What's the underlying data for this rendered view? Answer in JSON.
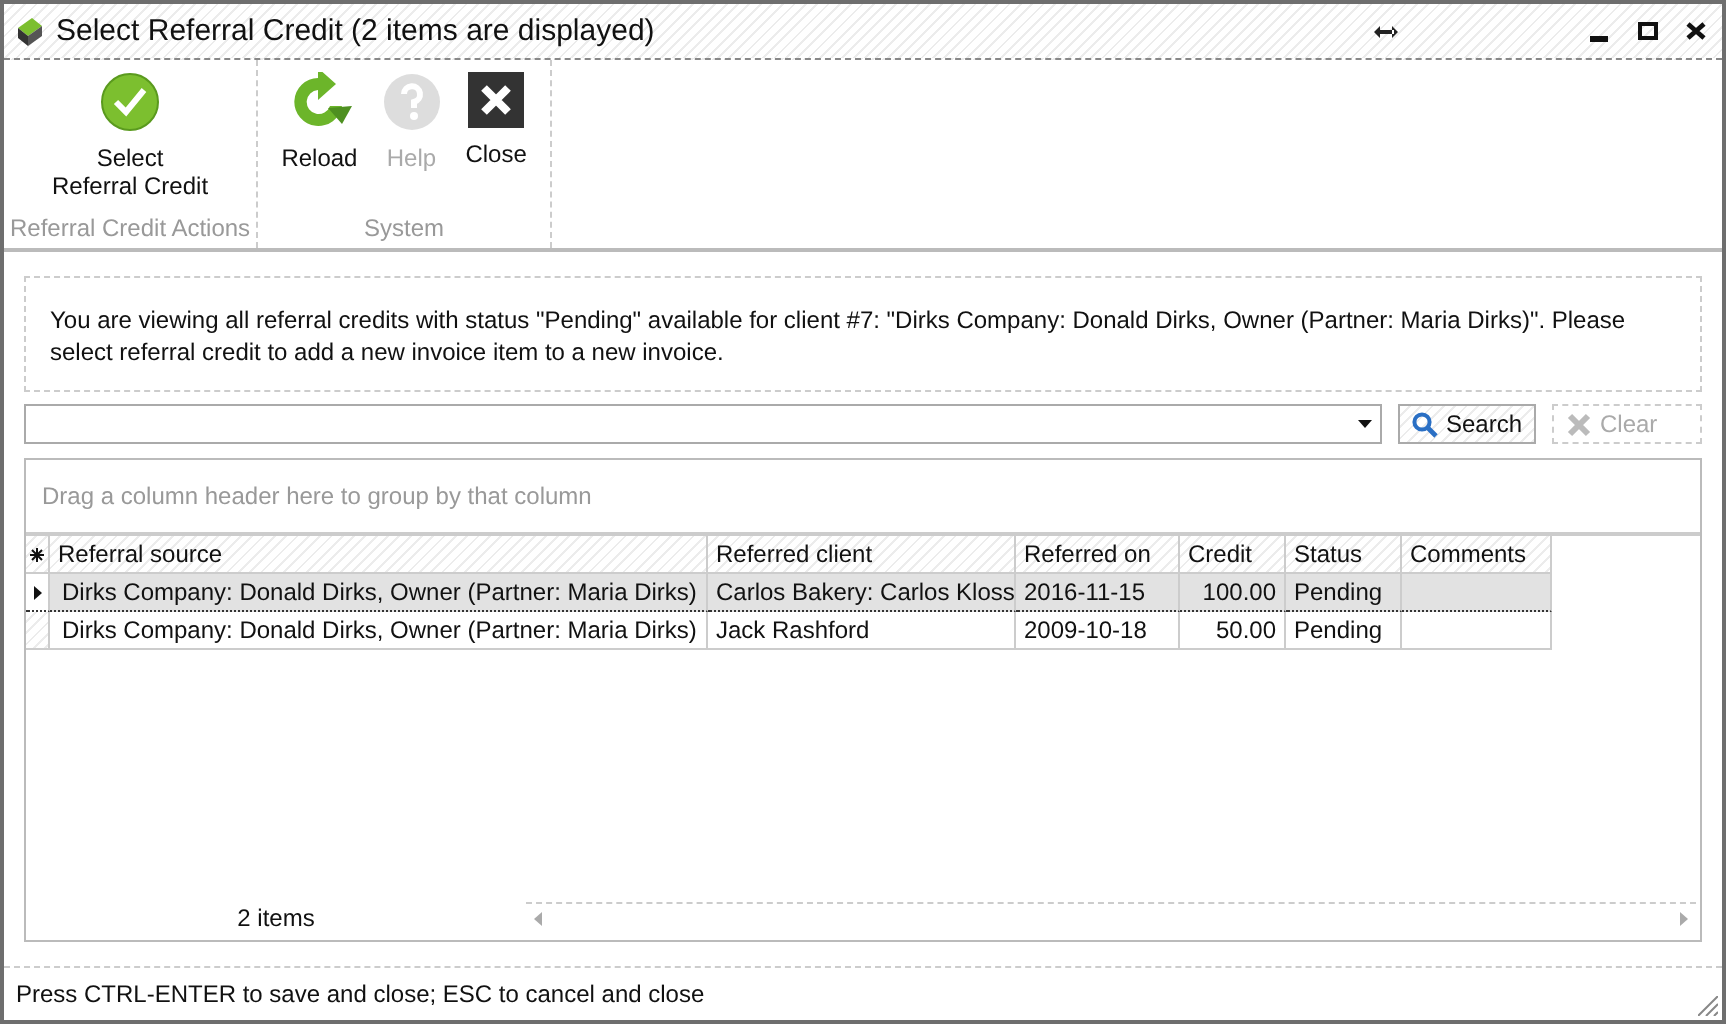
{
  "window": {
    "title": "Select Referral Credit (2 items are displayed)"
  },
  "ribbon": {
    "groups": [
      {
        "caption": "Referral Credit Actions",
        "buttons": [
          {
            "kind": "select",
            "label": "Select\nReferral Credit",
            "disabled": false
          }
        ]
      },
      {
        "caption": "System",
        "buttons": [
          {
            "kind": "reload",
            "label": "Reload",
            "disabled": false
          },
          {
            "kind": "help",
            "label": "Help",
            "disabled": true
          },
          {
            "kind": "close",
            "label": "Close",
            "disabled": false
          }
        ]
      }
    ]
  },
  "info": "You are viewing all referral credits with status \"Pending\" available for client #7: \"Dirks Company: Donald Dirks, Owner (Partner: Maria Dirks)\". Please select referral credit to add a new invoice item to a new invoice.",
  "search": {
    "search_button": {
      "label": "Search",
      "disabled": false
    },
    "clear_button": {
      "label": "Clear",
      "disabled": true
    }
  },
  "grid": {
    "group_hint": "Drag a column header here to group by that column",
    "columns": [
      "Referral source",
      "Referred client",
      "Referred on",
      "Credit",
      "Status",
      "Comments"
    ],
    "rows": [
      {
        "selected": true,
        "cells": [
          "Dirks Company: Donald Dirks, Owner (Partner: Maria Dirks)",
          "Carlos Bakery: Carlos Kloss",
          "2016-11-15",
          "100.00",
          "Pending",
          ""
        ]
      },
      {
        "selected": false,
        "cells": [
          "Dirks Company: Donald Dirks, Owner (Partner: Maria Dirks)",
          "Jack Rashford",
          "2009-10-18",
          "50.00",
          "Pending",
          ""
        ]
      }
    ],
    "footer_count": "2 items"
  },
  "status_bar": "Press CTRL-ENTER to save and close; ESC to cancel and close"
}
